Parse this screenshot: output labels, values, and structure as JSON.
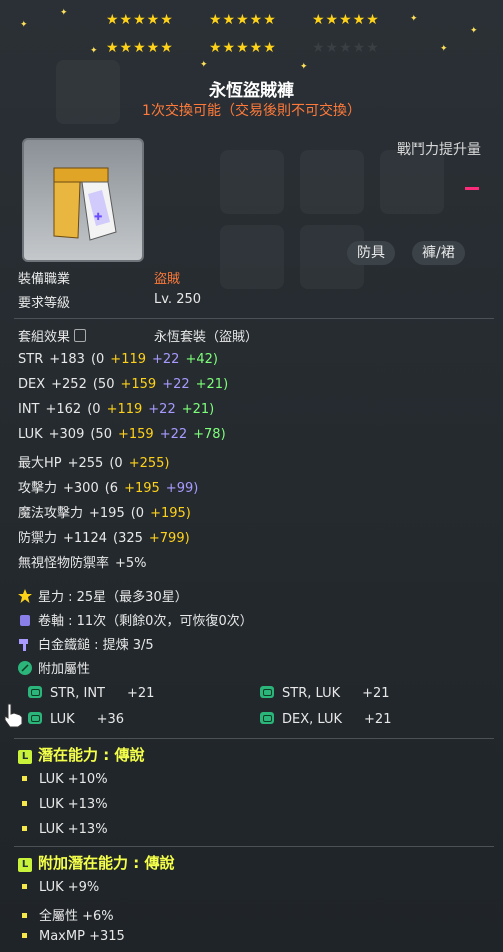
{
  "stars": {
    "row1": [
      "★★★★★",
      "★★★★★",
      "★★★★★"
    ],
    "row2_lit": [
      "★★★★★",
      "★★★★★"
    ],
    "row2_dim": "★★★★★"
  },
  "item": {
    "name": "永恆盜賊褲",
    "trade_note": "1次交換可能（交易後則不可交換）",
    "power_label": "戰鬥力提升量",
    "tags": [
      "防具",
      "褲/裙"
    ]
  },
  "requirements": {
    "job_label": "裝備職業",
    "job_value": "盜賊",
    "level_label": "要求等級",
    "level_value": "Lv. 250"
  },
  "set": {
    "label": "套組效果",
    "value": "永恆套裝（盜賊）"
  },
  "stats": [
    {
      "name": "STR",
      "total": "+183",
      "base": "(0",
      "a": "+119",
      "b": "+22",
      "c": "+42)"
    },
    {
      "name": "DEX",
      "total": "+252",
      "base": "(50",
      "a": "+159",
      "b": "+22",
      "c": "+21)"
    },
    {
      "name": "INT",
      "total": "+162",
      "base": "(0",
      "a": "+119",
      "b": "+22",
      "c": "+21)"
    },
    {
      "name": "LUK",
      "total": "+309",
      "base": "(50",
      "a": "+159",
      "b": "+22",
      "c": "+78)"
    },
    {
      "name": "最大HP",
      "total": "+255",
      "base": "(0",
      "a": "+255)",
      "b": "",
      "c": ""
    },
    {
      "name": "攻擊力",
      "total": "+300",
      "base": "(6",
      "a": "+195",
      "b": "+99)",
      "c": ""
    },
    {
      "name": "魔法攻擊力",
      "total": "+195",
      "base": "(0",
      "a": "+195)",
      "b": "",
      "c": ""
    },
    {
      "name": "防禦力",
      "total": "+1124",
      "base": "(325",
      "a": "+799)",
      "b": "",
      "c": ""
    },
    {
      "name": "無視怪物防禦率",
      "total": "+5%",
      "base": "",
      "a": "",
      "b": "",
      "c": ""
    }
  ],
  "info": {
    "star_force": "星力 : 25星（最多30星）",
    "scroll": "卷軸 : 11次（剩餘0次，可恢復0次）",
    "hammer": "白金鐵鎚 : 提煉 3/5",
    "bonus_title": "附加屬性"
  },
  "bonus_stats": [
    {
      "label": "STR, INT",
      "value": "+21"
    },
    {
      "label": "STR, LUK",
      "value": "+21"
    },
    {
      "label": "LUK",
      "value": "+36"
    },
    {
      "label": "DEX, LUK",
      "value": "+21"
    }
  ],
  "potential": {
    "title": "潛在能力 : 傳說",
    "lines": [
      "LUK +10%",
      "LUK +13%",
      "LUK +13%"
    ]
  },
  "additional_potential": {
    "title": "附加潛在能力 : 傳說",
    "lines": [
      "LUK +9%",
      "全屬性 +6%",
      "MaxMP +315"
    ]
  },
  "colors": {
    "gold": "#ffd21a",
    "orange": "#ff7a3a",
    "purple": "#a99aff",
    "green": "#7dff7a",
    "legend_yellow": "#f4ff4a"
  },
  "icons": [
    "star-icon",
    "scroll-icon",
    "hammer-icon",
    "leaf-icon",
    "bonus-icon",
    "legend-icon",
    "lock-icon",
    "hand-cursor-icon",
    "pants-item-icon"
  ]
}
